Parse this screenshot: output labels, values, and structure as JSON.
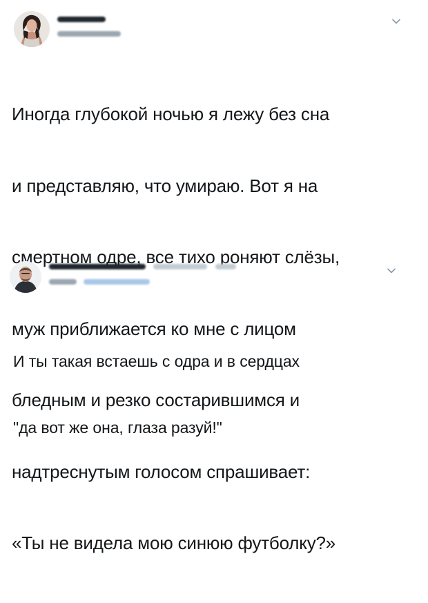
{
  "colors": {
    "text": "#14171a",
    "muted": "#8899a6",
    "blurred_name": "#20272e",
    "blurred_handle": "#9aa6b0",
    "blurred_link": "#a9c8e8"
  },
  "tweets": [
    {
      "avatar_icon": "user-avatar-woman-icon",
      "menu_icon": "chevron-down-icon",
      "text_lines": [
        "Иногда глубокой ночью я лежу без сна",
        "и представляю, что умираю. Вот я на",
        "смертном одре, все тихо роняют слёзы,",
        "муж приближается ко мне с лицом",
        "бледным и резко состарившимся и",
        "надтреснутым голосом спрашивает:",
        "«Ты не видела мою синюю футболку?»"
      ]
    },
    {
      "avatar_icon": "user-avatar-man-icon",
      "menu_icon": "chevron-down-icon",
      "text_lines": [
        "И ты такая встаешь с одра и в сердцах",
        "\"да вот же она, глаза разуй!\""
      ]
    }
  ]
}
